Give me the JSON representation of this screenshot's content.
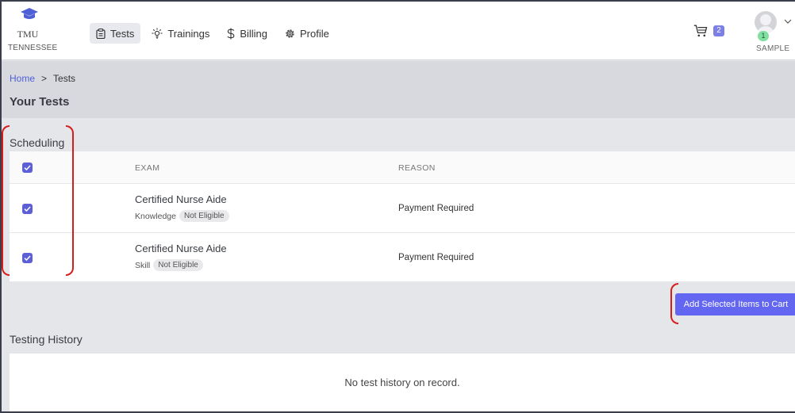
{
  "logo": {
    "abbr": "TMU",
    "state": "TENNESSEE"
  },
  "nav": [
    {
      "label": "Tests",
      "icon": "clipboard-icon",
      "active": true
    },
    {
      "label": "Trainings",
      "icon": "lightbulb-icon",
      "active": false
    },
    {
      "label": "Billing",
      "icon": "dollar-icon",
      "active": false
    },
    {
      "label": "Profile",
      "icon": "gear-icon",
      "active": false
    }
  ],
  "cart": {
    "count": "2"
  },
  "user": {
    "badge": "1",
    "name": "SAMPLE"
  },
  "breadcrumb": {
    "home": "Home",
    "separator": ">",
    "current": "Tests"
  },
  "page": {
    "title": "Your Tests"
  },
  "scheduling": {
    "label": "Scheduling",
    "columns": {
      "exam": "EXAM",
      "reason": "REASON"
    },
    "rows": [
      {
        "exam": "Certified Nurse Aide",
        "type": "Knowledge",
        "status": "Not Eligible",
        "reason": "Payment Required",
        "checked": true
      },
      {
        "exam": "Certified Nurse Aide",
        "type": "Skill",
        "status": "Not Eligible",
        "reason": "Payment Required",
        "checked": true
      }
    ]
  },
  "actions": {
    "add_to_cart": "Add Selected Items to Cart"
  },
  "history": {
    "label": "Testing History",
    "empty": "No test history on record."
  },
  "colors": {
    "accent": "#6366f1",
    "checkbox": "#5c5fd6",
    "annotation": "#d81b1b",
    "link": "#4d61d8"
  }
}
